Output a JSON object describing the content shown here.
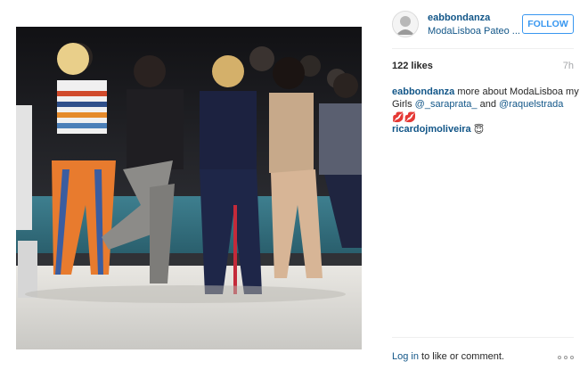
{
  "post": {
    "image_alt": "",
    "username": "eabbondanza",
    "location": "ModaLisboa Pateo ...",
    "follow_label": "FOLLOW",
    "likes": "122 likes",
    "time": "7h",
    "caption": {
      "username": "eabbondanza",
      "text_1": " more about ModaLisboa my Girls ",
      "mention_1": "@_saraprata_",
      "text_2": " and ",
      "mention_2": "@raquelstrada",
      "emoji": "💋💋"
    },
    "comments": [
      {
        "username": "ricardojmoliveira",
        "text": "😇"
      }
    ],
    "login_link": "Log in",
    "login_text": " to like or comment.",
    "more_icon": "ellipsis-icon"
  },
  "colors": {
    "link": "#125688",
    "accent": "#3897f0",
    "muted": "#a5a7aa"
  }
}
